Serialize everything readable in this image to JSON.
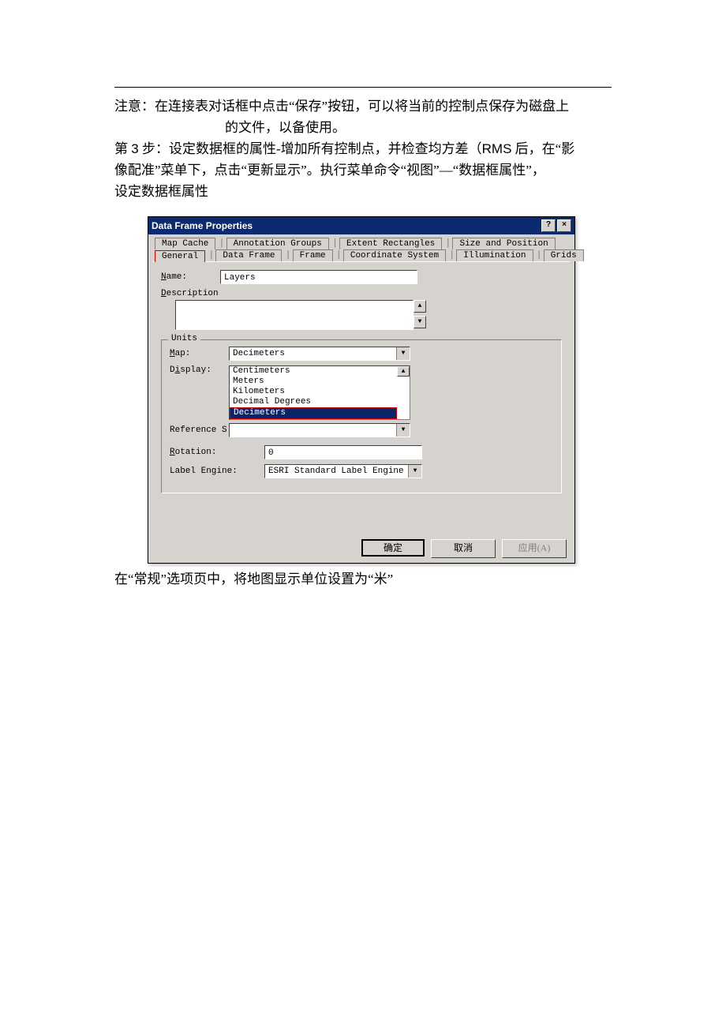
{
  "doc": {
    "note_line1": "注意：在连接表对话框中点击“保存”按钮，可以将当前的控制点保存为磁盘上",
    "note_line2": "的文件，以备使用。",
    "step_line1a": "第 ",
    "step_num": "3",
    "step_line1b": " 步：设定数据框的属性-增加所有控制点，并检查均方差（",
    "step_rms": "RMS",
    "step_line1c": " 后，在“影",
    "step_line2": "像配准”菜单下，点击“更新显示”。执行菜单命令“视图”—“数据框属性”，",
    "step_line3": "设定数据框属性",
    "caption": "在“常规”选项页中，将地图显示单位设置为“米”"
  },
  "dialog": {
    "title": "Data Frame Properties",
    "help_btn": "?",
    "close_btn": "×",
    "tabs_row1": [
      "Map Cache",
      "Annotation Groups",
      "Extent Rectangles",
      "Size and Position"
    ],
    "tabs_row2": [
      "General",
      "Data Frame",
      "Frame",
      "Coordinate System",
      "Illumination",
      "Grids"
    ],
    "name_label": "Name:",
    "name_value": "Layers",
    "desc_label": "Description",
    "units_legend": "Units",
    "map_label": "Map:",
    "map_value": "Decimeters",
    "display_label": "Display:",
    "display_options": [
      "Centimeters",
      "Meters",
      "Kilometers",
      "Decimal Degrees",
      "Decimeters"
    ],
    "reference_label": "Reference S",
    "rotation_label": "Rotation:",
    "rotation_value": "0",
    "engine_label": "Label Engine:",
    "engine_value": "ESRI Standard Label Engine",
    "btn_ok": "确定",
    "btn_cancel": "取消",
    "btn_apply": "应用(A)"
  }
}
